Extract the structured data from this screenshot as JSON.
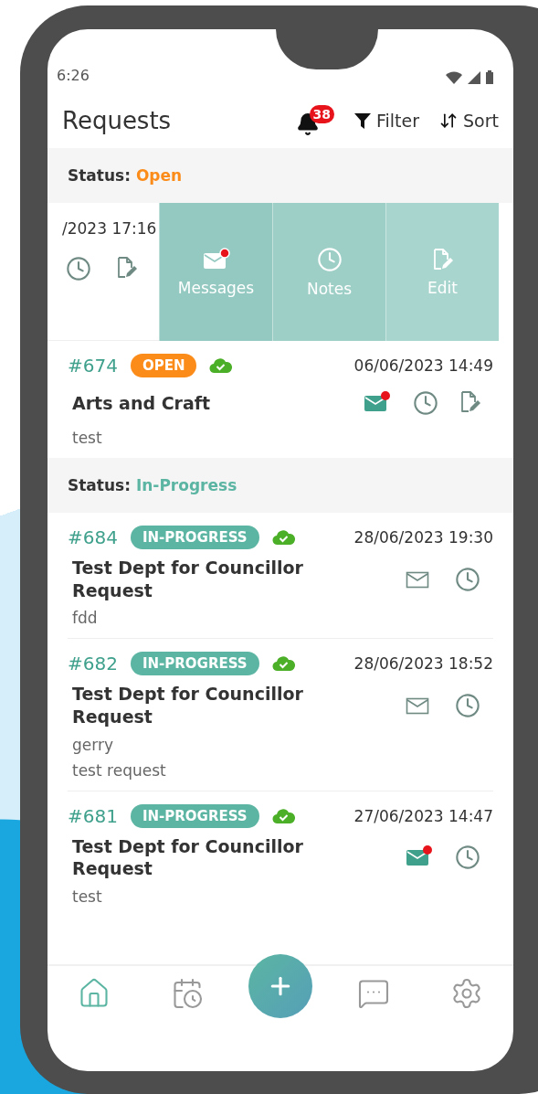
{
  "status_bar": {
    "time": "6:26"
  },
  "header": {
    "title": "Requests",
    "notification_count": "38",
    "filter_label": "Filter",
    "sort_label": "Sort"
  },
  "sections": [
    {
      "label": "Status:",
      "value": "Open",
      "color": "#fb8c1a",
      "items": [
        {
          "kind": "swiped",
          "date": "/2023 17:16",
          "icons": [
            {
              "kind": "notes"
            },
            {
              "kind": "edit"
            }
          ],
          "actions": [
            {
              "kind": "message",
              "label": "Messages",
              "unread": true
            },
            {
              "kind": "notes",
              "label": "Notes"
            },
            {
              "kind": "edit",
              "label": "Edit"
            }
          ]
        },
        {
          "kind": "card",
          "number": "#674",
          "badge": "OPEN",
          "synced": true,
          "date": "06/06/2023 14:49",
          "title": "Arts and Craft",
          "icons": [
            {
              "kind": "message",
              "unread": true
            },
            {
              "kind": "notes"
            },
            {
              "kind": "edit"
            }
          ],
          "lines": [
            "test"
          ]
        }
      ]
    },
    {
      "label": "Status:",
      "value": "In-Progress",
      "color": "#5bb5a2",
      "items": [
        {
          "kind": "card",
          "number": "#684",
          "badge": "IN-PROGRESS",
          "synced": true,
          "date": "28/06/2023 19:30",
          "title": "Test Dept for Councillor Request",
          "icons": [
            {
              "kind": "message",
              "unread": false
            },
            {
              "kind": "notes"
            }
          ],
          "lines": [
            "fdd"
          ]
        },
        {
          "kind": "card",
          "number": "#682",
          "badge": "IN-PROGRESS",
          "synced": true,
          "date": "28/06/2023 18:52",
          "title": "Test Dept for Councillor Request",
          "icons": [
            {
              "kind": "message",
              "unread": false
            },
            {
              "kind": "notes"
            }
          ],
          "lines": [
            "gerry",
            "test request"
          ]
        },
        {
          "kind": "card",
          "number": "#681",
          "badge": "IN-PROGRESS",
          "synced": true,
          "date": "27/06/2023 14:47",
          "title": "Test Dept for Councillor Request",
          "icons": [
            {
              "kind": "message",
              "unread": true
            },
            {
              "kind": "notes"
            }
          ],
          "lines": [
            "test"
          ]
        }
      ]
    }
  ],
  "nav": [
    {
      "kind": "home",
      "selected": true
    },
    {
      "kind": "calendar",
      "selected": false
    },
    {
      "kind": "add",
      "selected": false
    },
    {
      "kind": "chat",
      "selected": false
    },
    {
      "kind": "settings",
      "selected": false
    }
  ]
}
